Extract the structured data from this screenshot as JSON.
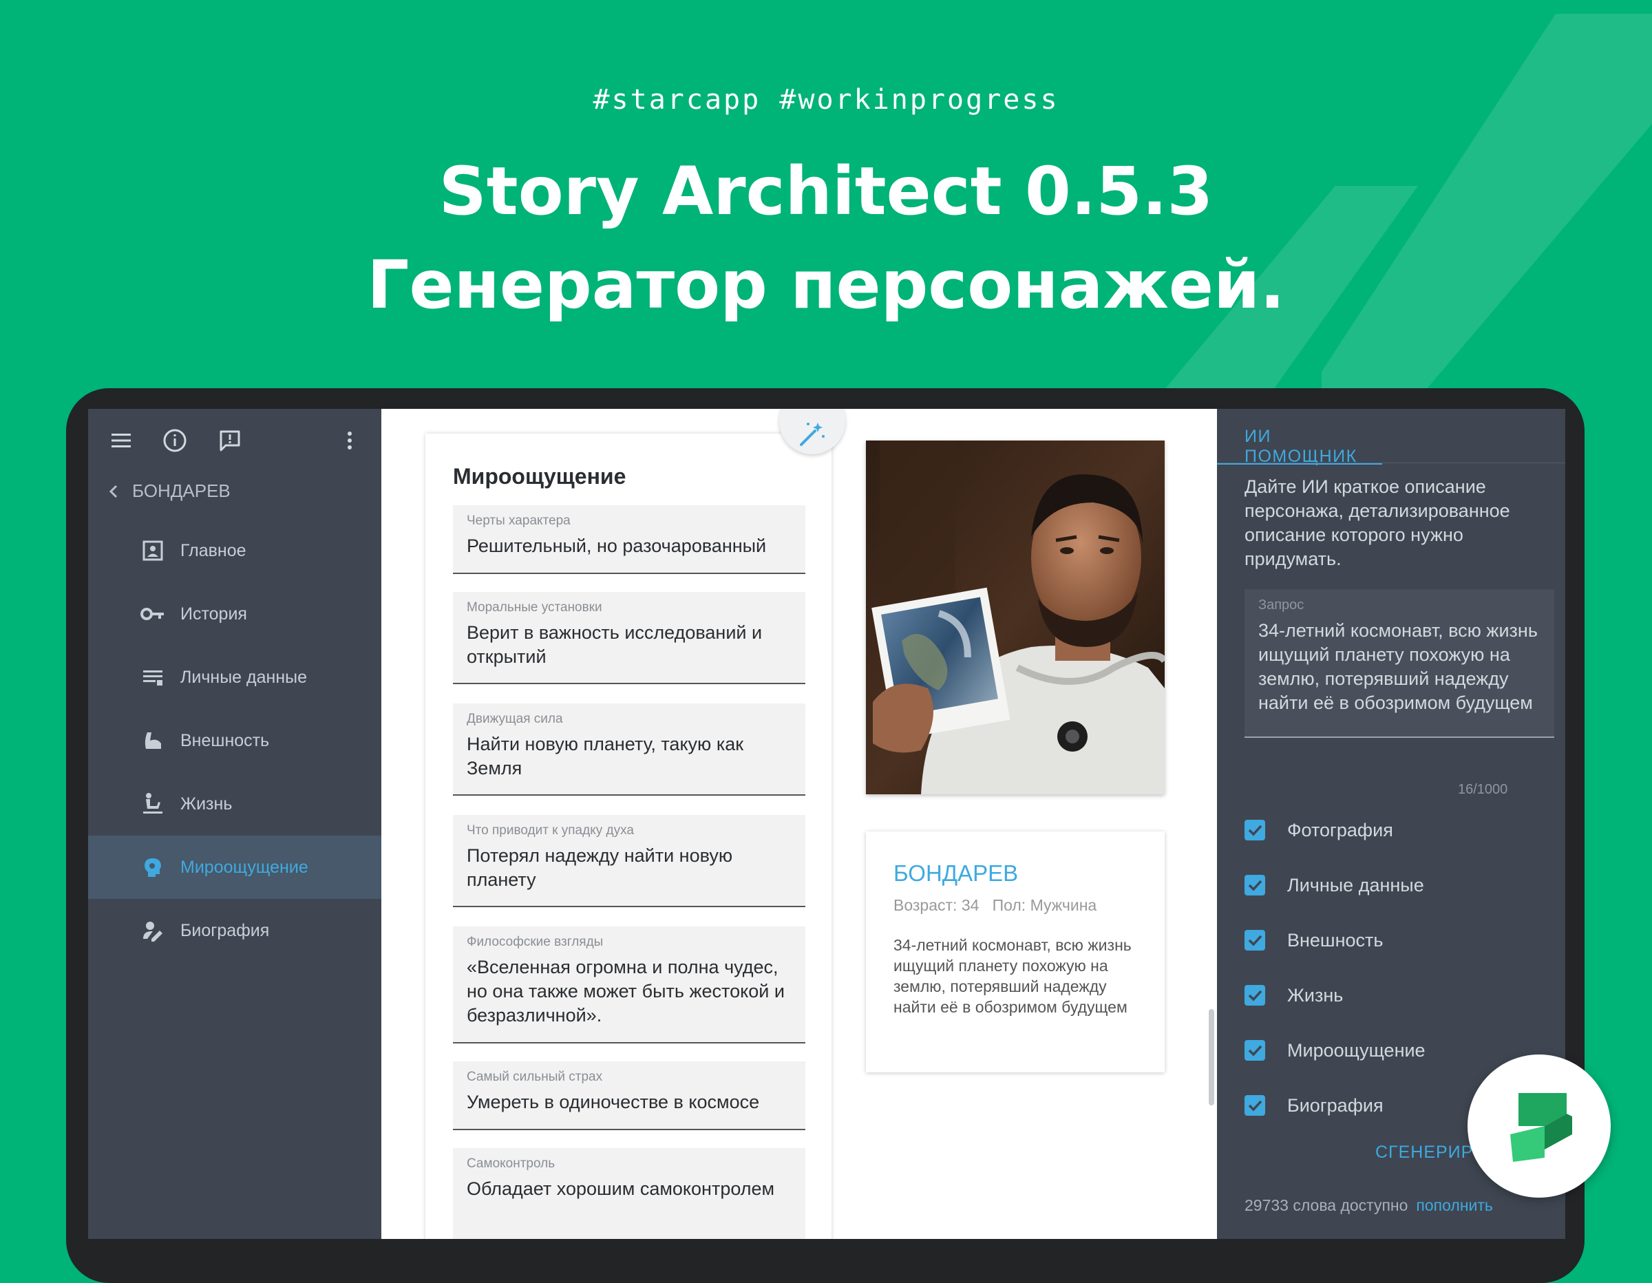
{
  "header": {
    "tags": "#starcapp  #workinprogress",
    "title_line1": "Story Architect 0.5.3",
    "title_line2": "Генератор персонажей."
  },
  "sidebar": {
    "icons": [
      "menu-icon",
      "info-icon",
      "feedback-icon",
      "more-vert-icon"
    ],
    "back_label": "БОНДАРЕВ",
    "items": [
      {
        "label": "Главное",
        "icon": "portrait-icon",
        "active": false
      },
      {
        "label": "История",
        "icon": "key-icon",
        "active": false
      },
      {
        "label": "Личные данные",
        "icon": "list-icon",
        "active": false
      },
      {
        "label": "Внешность",
        "icon": "arm-icon",
        "active": false
      },
      {
        "label": "Жизнь",
        "icon": "life-icon",
        "active": false
      },
      {
        "label": "Мироощущение",
        "icon": "head-icon",
        "active": true
      },
      {
        "label": "Биография",
        "icon": "person-edit-icon",
        "active": false
      }
    ]
  },
  "form": {
    "title": "Мироощущение",
    "fields": [
      {
        "label": "Черты характера",
        "value": "Решительный, но разочарованный"
      },
      {
        "label": "Моральные установки",
        "value": "Верит в важность исследований и открытий"
      },
      {
        "label": "Движущая сила",
        "value": "Найти новую планету, такую как Земля"
      },
      {
        "label": "Что приводит к упадку духа",
        "value": "Потерял надежду найти новую планету"
      },
      {
        "label": "Философские взгляды",
        "value": "«Вселенная огромна и полна чудес, но она также может быть жестокой и безразличной»."
      },
      {
        "label": "Самый сильный страх",
        "value": "Умереть в одиночестве в космосе"
      },
      {
        "label": "Самоконтроль",
        "value": "Обладает хорошим самоконтролем"
      }
    ]
  },
  "character": {
    "name": "БОНДАРЕВ",
    "meta": "Возраст: 34   Пол: Мужчина",
    "description": "34-летний космонавт, всю жизнь ищущий планету похожую на землю, потерявший надежду найти её в обозримом будущем"
  },
  "ai": {
    "tab": "ИИ ПОМОЩНИК",
    "description": "Дайте ИИ краткое описание персонажа, детализированное описание которого нужно придумать.",
    "query_label": "Запрос",
    "query_value": "34-летний космонавт, всю жизнь ищущий планету похожую на землю, потерявший надежду найти её в обозримом будущем",
    "counter": "16/1000",
    "checkboxes": [
      {
        "label": "Фотография",
        "checked": true
      },
      {
        "label": "Личные данные",
        "checked": true
      },
      {
        "label": "Внешность",
        "checked": true
      },
      {
        "label": "Жизнь",
        "checked": true
      },
      {
        "label": "Мироощущение",
        "checked": true
      },
      {
        "label": "Биография",
        "checked": true
      }
    ],
    "generate_label": "СГЕНЕРИРОВАТЬ",
    "words_available": "29733 слова доступно",
    "topup_label": "пополнить"
  },
  "colors": {
    "background": "#00B377",
    "sidebar": "#3F4651",
    "accent": "#3FA9E0",
    "active_item": "#47596A"
  }
}
